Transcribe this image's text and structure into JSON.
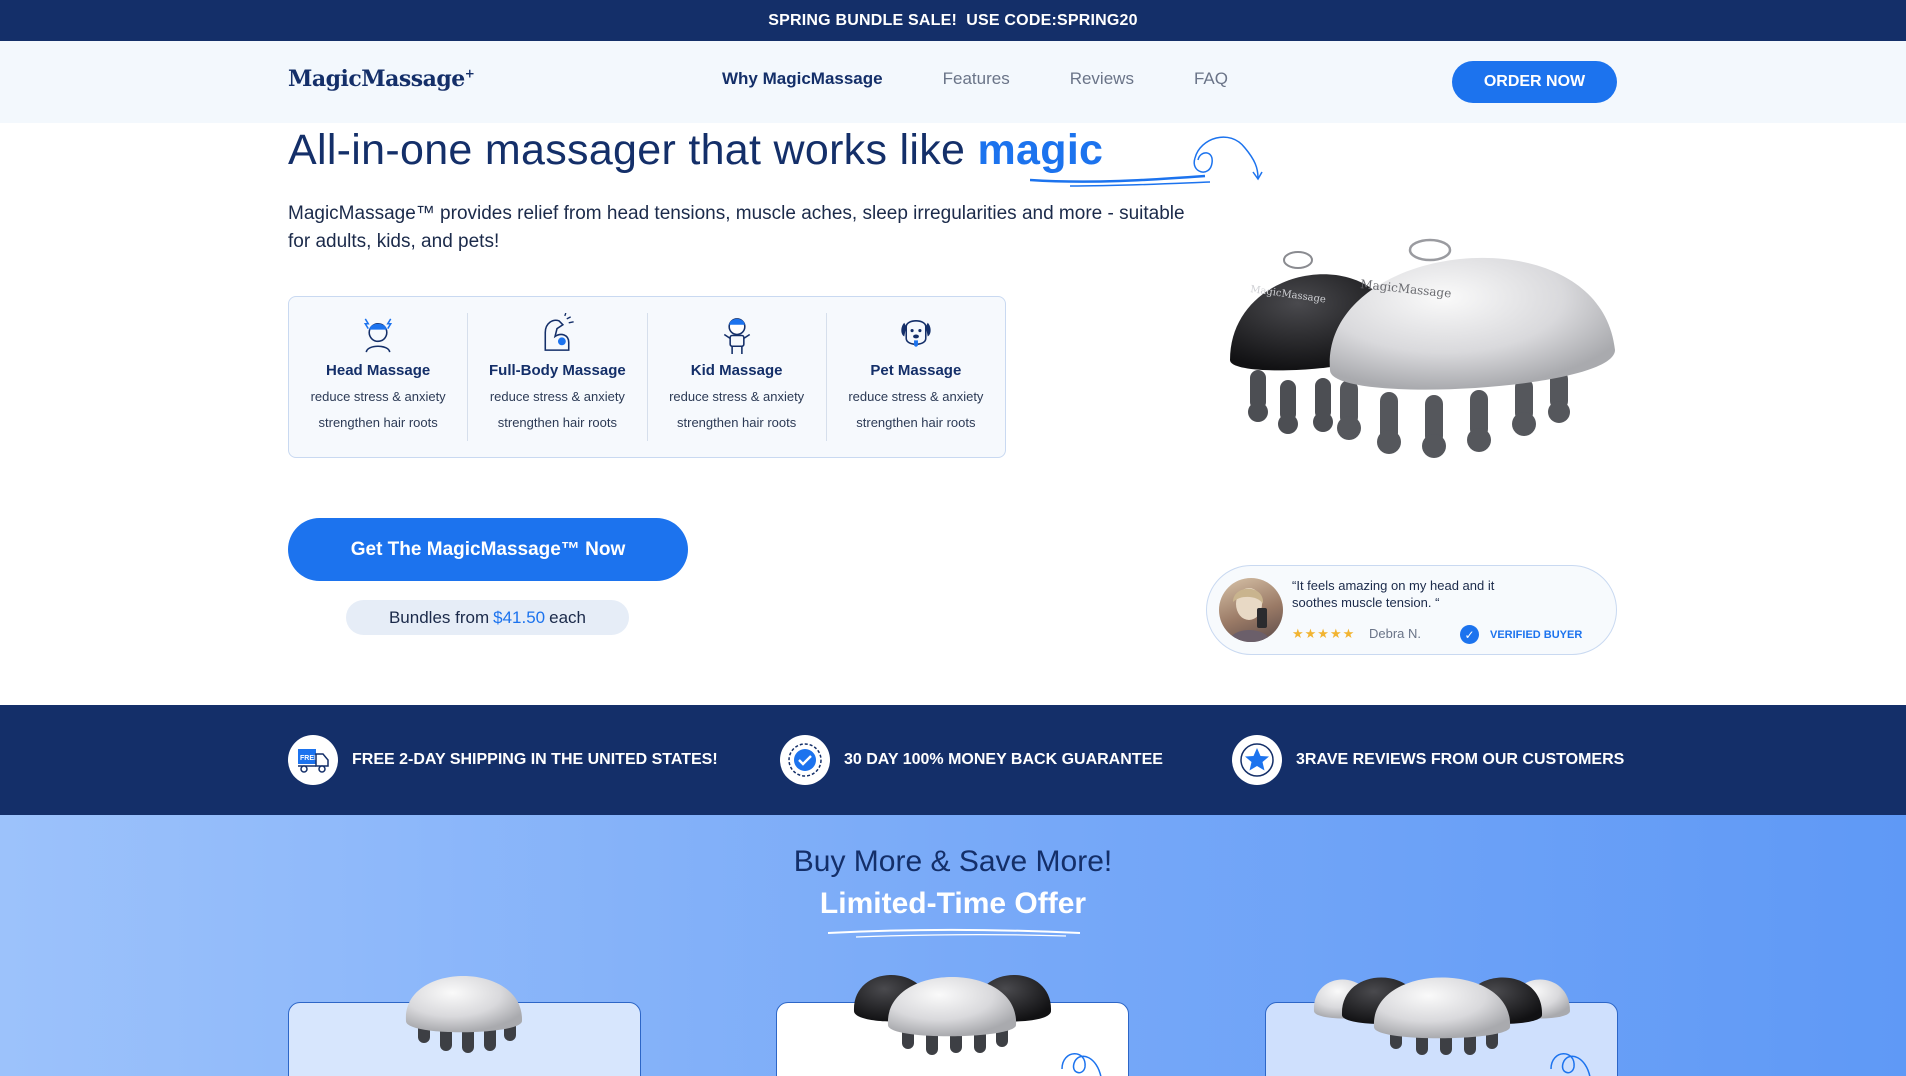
{
  "promo_banner": {
    "text": "SPRING BUNDLE SALE!  USE CODE:SPRING20"
  },
  "nav": {
    "logo": "MagicMassage",
    "logo_mark": "+",
    "items": [
      {
        "label": "Why MagicMassage",
        "active": true
      },
      {
        "label": "Features",
        "active": false
      },
      {
        "label": "Reviews",
        "active": false
      },
      {
        "label": "FAQ",
        "active": false
      }
    ],
    "order_button": "ORDER NOW"
  },
  "hero": {
    "title_prefix": "All-in-one massager that works like ",
    "title_highlight": "magic",
    "subtitle": "MagicMassage™ provides relief from head tensions, muscle aches, sleep irregularities and more - suitable for adults, kids, and pets!",
    "features": [
      {
        "icon": "head-massage-icon",
        "title": "Head Massage",
        "line1": "reduce stress & anxiety",
        "line2": "strengthen hair roots"
      },
      {
        "icon": "body-massage-icon",
        "title": "Full-Body Massage",
        "line1": "reduce stress & anxiety",
        "line2": "strengthen hair roots"
      },
      {
        "icon": "kid-icon",
        "title": "Kid Massage",
        "line1": "reduce stress & anxiety",
        "line2": "strengthen hair roots"
      },
      {
        "icon": "dog-icon",
        "title": "Pet Massage",
        "line1": "reduce stress & anxiety",
        "line2": "strengthen hair roots"
      }
    ],
    "cta_button": "Get The MagicMassage™ Now",
    "bundle_prefix": "Bundles from",
    "bundle_price": "$41.50",
    "bundle_suffix": "each",
    "product_label": "MagicMassage"
  },
  "review": {
    "quote": "“It feels amazing on my head and it soothes muscle tension. “",
    "stars": "★★★★★",
    "reviewer": "Debra N.",
    "verified": "VERIFIED BUYER"
  },
  "benefits": [
    {
      "icon": "truck-icon",
      "icon_text": "FREE",
      "text": "FREE 2-DAY SHIPPING IN THE UNITED STATES!"
    },
    {
      "icon": "guarantee-badge-icon",
      "text": "30 DAY 100% MONEY BACK GUARANTEE"
    },
    {
      "icon": "star-icon",
      "text": "3RAVE REVIEWS FROM OUR CUSTOMERS"
    }
  ],
  "offer": {
    "title": "Buy More & Save More!",
    "subtitle": "Limited-Time Offer"
  },
  "colors": {
    "navy": "#142f69",
    "accent": "#1c73ee",
    "star": "#f2b431"
  }
}
